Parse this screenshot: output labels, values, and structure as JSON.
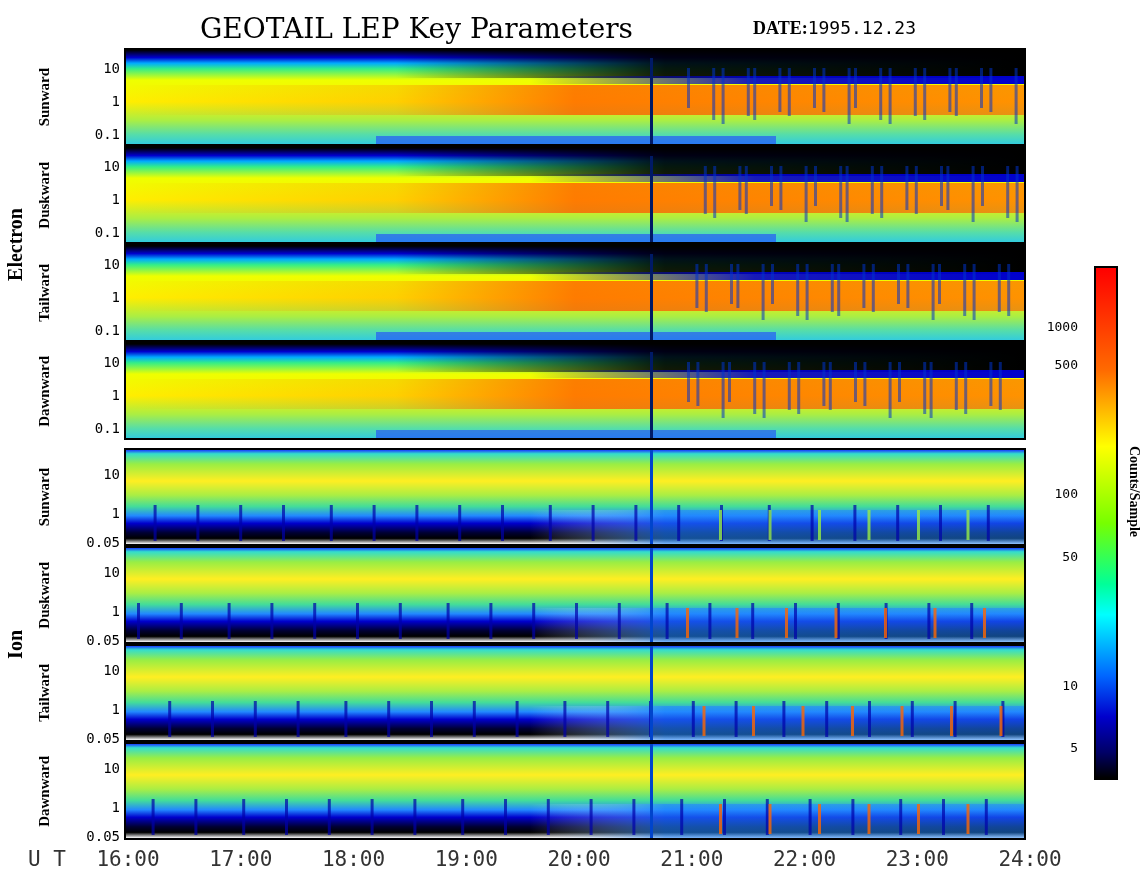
{
  "title": "GEOTAIL LEP Key Parameters",
  "date_label": "DATE:",
  "date": "1995.12.23",
  "groups": [
    {
      "name": "Electron",
      "kind": "electron",
      "panels": [
        {
          "direction": "Sunward",
          "yticks": [
            "10",
            "1",
            "0.1"
          ]
        },
        {
          "direction": "Duskward",
          "yticks": [
            "10",
            "1",
            "0.1"
          ]
        },
        {
          "direction": "Tailward",
          "yticks": [
            "10",
            "1",
            "0.1"
          ]
        },
        {
          "direction": "Dawnward",
          "yticks": [
            "10",
            "1",
            "0.1"
          ]
        }
      ]
    },
    {
      "name": "Ion",
      "kind": "ion",
      "panels": [
        {
          "direction": "Sunward",
          "yticks": [
            "10",
            "1",
            "0.05"
          ]
        },
        {
          "direction": "Duskward",
          "yticks": [
            "10",
            "1",
            "0.05"
          ]
        },
        {
          "direction": "Tailward",
          "yticks": [
            "10",
            "1",
            "0.05"
          ]
        },
        {
          "direction": "Dawnward",
          "yticks": [
            "10",
            "1",
            "0.05"
          ]
        }
      ]
    }
  ],
  "xaxis": {
    "label": "U T",
    "ticks": [
      "16:00",
      "17:00",
      "18:00",
      "19:00",
      "20:00",
      "21:00",
      "22:00",
      "23:00",
      "24:00"
    ]
  },
  "colorbar": {
    "label": "Counts/Sample",
    "ticks": [
      "1000",
      "500",
      "100",
      "50",
      "10",
      "5"
    ]
  }
}
